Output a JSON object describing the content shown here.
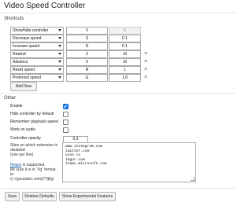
{
  "page": {
    "title": "Video Speed Controller"
  },
  "shortcuts": {
    "heading": "Shortcuts",
    "rows": [
      {
        "action": "Show/hide controller",
        "key": "V",
        "value": "0",
        "value_disabled": true
      },
      {
        "action": "Decrease speed",
        "key": "S",
        "value": "0.1",
        "value_disabled": false
      },
      {
        "action": "Increase speed",
        "key": "D",
        "value": "0.1",
        "value_disabled": false
      },
      {
        "action": "Rewind",
        "key": "Z",
        "value": "10",
        "value_disabled": false
      },
      {
        "action": "Advance",
        "key": "X",
        "value": "10",
        "value_disabled": false
      },
      {
        "action": "Reset speed",
        "key": "R",
        "value": "1",
        "value_disabled": false
      },
      {
        "action": "Preferred speed",
        "key": "G",
        "value": "1.8",
        "value_disabled": false
      }
    ],
    "remove_glyph": "×",
    "add_new_label": "Add New"
  },
  "other": {
    "heading": "Other",
    "enable_label": "Enable",
    "enable_checked": true,
    "hide_default_label": "Hide controller by default",
    "hide_default_checked": false,
    "remember_label": "Remember playback speed",
    "remember_checked": false,
    "audio_label": "Work on audio",
    "audio_checked": false,
    "opacity_label": "Controller opacity",
    "opacity_value": "0.3",
    "blacklist_label_line1": "Sites on which extension is",
    "blacklist_label_line2": "disabled",
    "blacklist_label_line3": "(one per line)",
    "regex_link": "Regex",
    "regex_supported": " is supported.",
    "regex_hint_line1": "Be sure it is in \"//g\" format.",
    "regex_hint_line2": "ie:",
    "regex_hint_line3": "/(.+)youtube\\.com(\\/*)$/gi",
    "blacklist_lines": [
      "www.instagram.com",
      "twitter.com",
      "vine.co",
      "imgur.com",
      "teams.microsoft.com"
    ]
  },
  "footer": {
    "save_label": "Save",
    "restore_label": "Restore Defaults",
    "experimental_label": "Show Experimental Features"
  }
}
